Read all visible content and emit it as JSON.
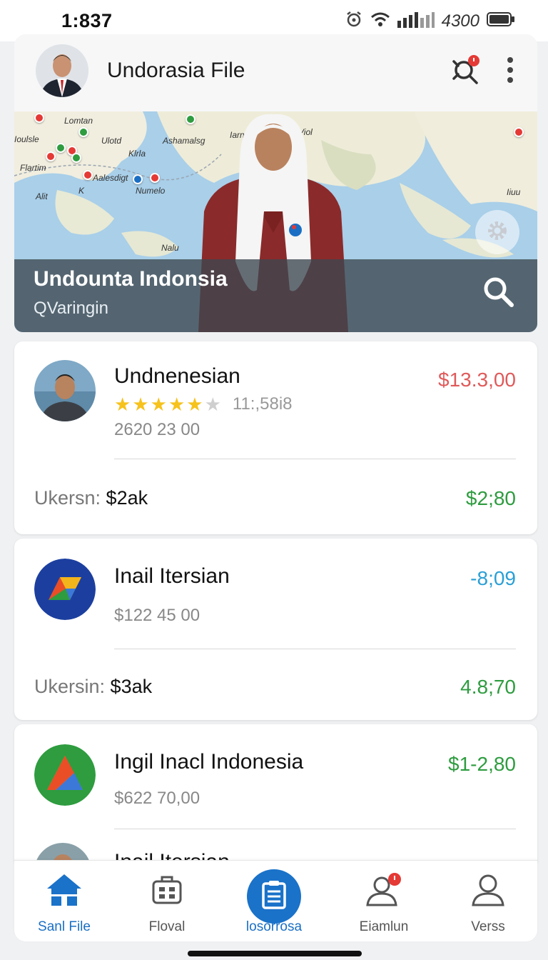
{
  "status_bar": {
    "time": "1:837",
    "battery": "4300",
    "icons": [
      "alarm-icon",
      "wifi-icon",
      "signal-icon",
      "battery-icon"
    ]
  },
  "app_bar": {
    "title": "Undorasia File",
    "icons": [
      "notification-search-icon",
      "more-vert-icon"
    ],
    "accent": "#e53935"
  },
  "hero": {
    "title": "Undounta Indonsia",
    "subtitle": "QVaringin",
    "map_labels": [
      "Lomtan",
      "Ioulsle",
      "Flartim",
      "Ulotd",
      "Aalesdigt",
      "Alit",
      "K",
      "Numelo",
      "Klrla",
      "Ashamalsg",
      "Iarni",
      "Viol",
      "Iiuu",
      "Nalu"
    ],
    "icons": [
      "search-icon",
      "gear-icon"
    ]
  },
  "cards": [
    {
      "name": "Undnenesian",
      "price": "$13.3,00",
      "price_color": "#e05a5a",
      "rating": 4,
      "rating_max": 5,
      "rating_text": "11:,58i8",
      "sub": "2620 23 00",
      "foot_label": "Ukersn:",
      "foot_amount": "$2ak",
      "foot_value": "$2;80"
    },
    {
      "name": "Inail Itersian",
      "price": "-8;09",
      "price_color": "#2a9fd6",
      "sub": "$122 45 00",
      "foot_label": "Ukersin:",
      "foot_amount": "$3ak",
      "foot_value": "4.8;70"
    },
    {
      "name": "Ingil Inacl Indonesia",
      "price": "$1-2,80",
      "price_color": "#2e9c3f",
      "sub": "$622 70,00",
      "next_name": "Inail Itersian"
    }
  ],
  "bottom_nav": {
    "items": [
      {
        "label": "Sanl File",
        "icon": "home-icon",
        "active": true
      },
      {
        "label": "Floval",
        "icon": "briefcase-icon",
        "active": false
      },
      {
        "label": "losorrosa",
        "icon": "clipboard-icon",
        "active": false
      },
      {
        "label": "Eiamlun",
        "icon": "profile-alert-icon",
        "active": false
      },
      {
        "label": "Verss",
        "icon": "user-icon",
        "active": false
      }
    ],
    "active_color": "#1a6fc5"
  }
}
